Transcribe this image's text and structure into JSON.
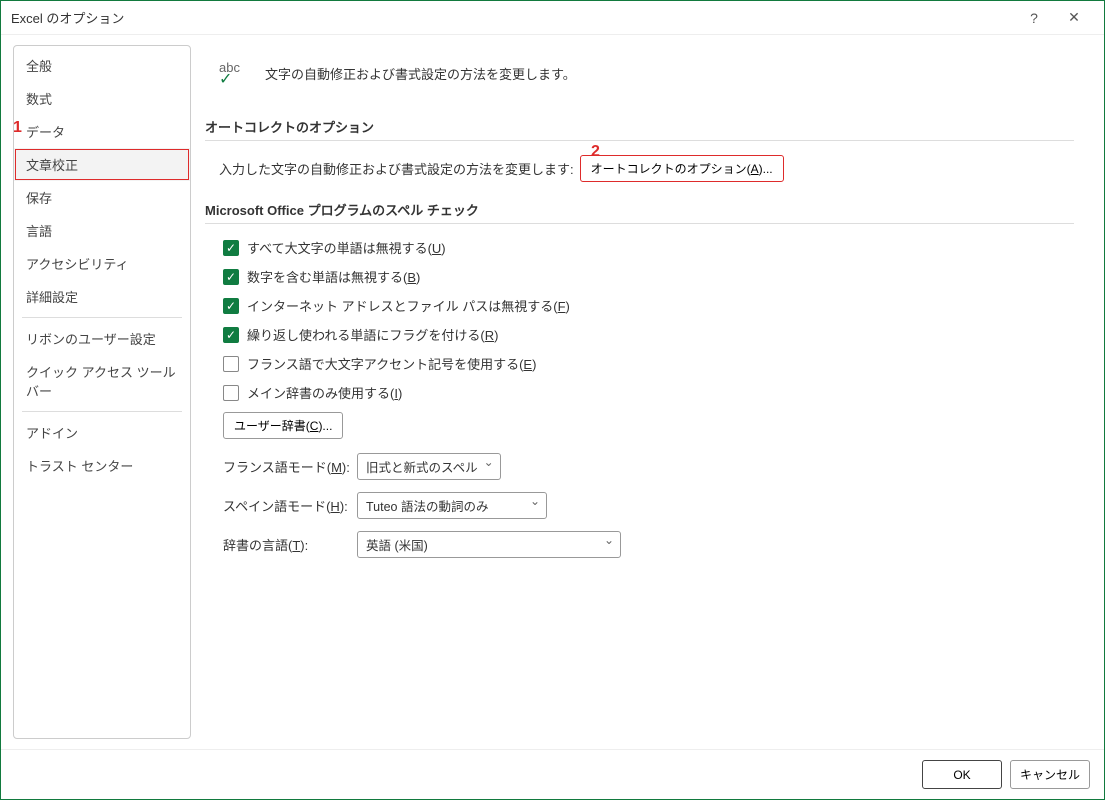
{
  "window": {
    "title": "Excel のオプション"
  },
  "sidebar": {
    "items": [
      {
        "label": "全般"
      },
      {
        "label": "数式"
      },
      {
        "label": "データ"
      },
      {
        "label": "文章校正",
        "selected": true
      },
      {
        "label": "保存"
      },
      {
        "label": "言語"
      },
      {
        "label": "アクセシビリティ"
      },
      {
        "label": "詳細設定"
      }
    ],
    "items2": [
      {
        "label": "リボンのユーザー設定"
      },
      {
        "label": "クイック アクセス ツール バー"
      }
    ],
    "items3": [
      {
        "label": "アドイン"
      },
      {
        "label": "トラスト センター"
      }
    ]
  },
  "hero": {
    "text": "文字の自動修正および書式設定の方法を変更します。",
    "icon_label": "abc"
  },
  "autocorrect": {
    "title": "オートコレクトのオプション",
    "desc": "入力した文字の自動修正および書式設定の方法を変更します:",
    "button_prefix": "オートコレクトのオプション(",
    "button_key": "A",
    "button_suffix": ")..."
  },
  "spell": {
    "title": "Microsoft Office プログラムのスペル チェック",
    "checks": [
      {
        "checked": true,
        "label_prefix": "すべて大文字の単語は無視する(",
        "key": "U",
        "label_suffix": ")"
      },
      {
        "checked": true,
        "label_prefix": "数字を含む単語は無視する(",
        "key": "B",
        "label_suffix": ")"
      },
      {
        "checked": true,
        "label_prefix": "インターネット アドレスとファイル パスは無視する(",
        "key": "F",
        "label_suffix": ")"
      },
      {
        "checked": true,
        "label_prefix": "繰り返し使われる単語にフラグを付ける(",
        "key": "R",
        "label_suffix": ")"
      },
      {
        "checked": false,
        "label_prefix": "フランス語で大文字アクセント記号を使用する(",
        "key": "E",
        "label_suffix": ")"
      },
      {
        "checked": false,
        "label_prefix": "メイン辞書のみ使用する(",
        "key": "I",
        "label_suffix": ")"
      }
    ],
    "custom_dict_prefix": "ユーザー辞書(",
    "custom_dict_key": "C",
    "custom_dict_suffix": ")...",
    "french": {
      "label_prefix": "フランス語モード(",
      "key": "M",
      "label_suffix": "):",
      "value": "旧式と新式のスペル"
    },
    "spanish": {
      "label_prefix": "スペイン語モード(",
      "key": "H",
      "label_suffix": "):",
      "value": "Tuteo 語法の動詞のみ"
    },
    "dict_lang": {
      "label_prefix": "辞書の言語(",
      "key": "T",
      "label_suffix": "):",
      "value": "英語 (米国)"
    }
  },
  "footer": {
    "ok": "OK",
    "cancel": "キャンセル"
  },
  "annotations": {
    "one": "1",
    "two": "2"
  }
}
